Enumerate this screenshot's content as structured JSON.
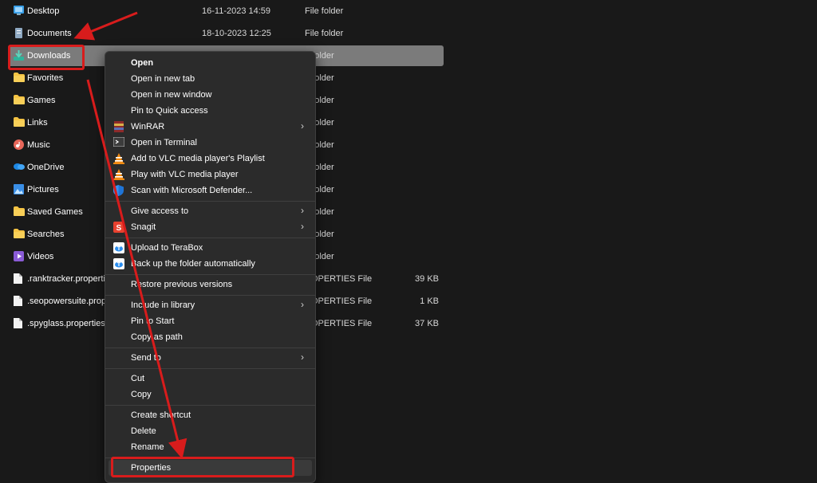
{
  "files": [
    {
      "name": "Desktop",
      "date": "16-11-2023 14:59",
      "type": "File folder",
      "size": "",
      "icon": "desktop-icon"
    },
    {
      "name": "Documents",
      "date": "18-10-2023 12:25",
      "type": "File folder",
      "size": "",
      "icon": "documents-icon"
    },
    {
      "name": "Downloads",
      "date": "",
      "type": "e folder",
      "size": "",
      "icon": "downloads-icon",
      "selected": true
    },
    {
      "name": "Favorites",
      "date": "",
      "type": "e folder",
      "size": "",
      "icon": "folder-icon"
    },
    {
      "name": "Games",
      "date": "",
      "type": "e folder",
      "size": "",
      "icon": "folder-icon"
    },
    {
      "name": "Links",
      "date": "",
      "type": "e folder",
      "size": "",
      "icon": "folder-icon"
    },
    {
      "name": "Music",
      "date": "",
      "type": "e folder",
      "size": "",
      "icon": "music-icon"
    },
    {
      "name": "OneDrive",
      "date": "",
      "type": "e folder",
      "size": "",
      "icon": "onedrive-icon"
    },
    {
      "name": "Pictures",
      "date": "",
      "type": "e folder",
      "size": "",
      "icon": "pictures-icon"
    },
    {
      "name": "Saved Games",
      "date": "",
      "type": "e folder",
      "size": "",
      "icon": "folder-icon"
    },
    {
      "name": "Searches",
      "date": "",
      "type": "e folder",
      "size": "",
      "icon": "folder-icon"
    },
    {
      "name": "Videos",
      "date": "",
      "type": "e folder",
      "size": "",
      "icon": "videos-icon"
    },
    {
      "name": ".ranktracker.properties",
      "date": "",
      "type": "ROPERTIES File",
      "size": "39 KB",
      "icon": "file-icon"
    },
    {
      "name": ".seopowersuite.properties",
      "date": "",
      "type": "ROPERTIES File",
      "size": "1 KB",
      "icon": "file-icon"
    },
    {
      "name": ".spyglass.properties",
      "date": "",
      "type": "ROPERTIES File",
      "size": "37 KB",
      "icon": "file-icon"
    }
  ],
  "menu": {
    "groups": [
      [
        {
          "label": "Open",
          "bold": true
        },
        {
          "label": "Open in new tab"
        },
        {
          "label": "Open in new window"
        },
        {
          "label": "Pin to Quick access"
        },
        {
          "label": "WinRAR",
          "icon": "winrar-icon",
          "submenu": true
        },
        {
          "label": "Open in Terminal",
          "icon": "terminal-icon"
        },
        {
          "label": "Add to VLC media player's Playlist",
          "icon": "vlc-icon"
        },
        {
          "label": "Play with VLC media player",
          "icon": "vlc-icon"
        },
        {
          "label": "Scan with Microsoft Defender...",
          "icon": "defender-shield-icon"
        }
      ],
      [
        {
          "label": "Give access to",
          "submenu": true
        },
        {
          "label": "Snagit",
          "icon": "snagit-icon",
          "submenu": true
        }
      ],
      [
        {
          "label": "Upload to TeraBox",
          "icon": "terabox-icon"
        },
        {
          "label": "Back up the folder automatically",
          "icon": "terabox-icon"
        }
      ],
      [
        {
          "label": "Restore previous versions"
        }
      ],
      [
        {
          "label": "Include in library",
          "submenu": true
        },
        {
          "label": "Pin to Start"
        },
        {
          "label": "Copy as path"
        }
      ],
      [
        {
          "label": "Send to",
          "submenu": true
        }
      ],
      [
        {
          "label": "Cut"
        },
        {
          "label": "Copy"
        }
      ],
      [
        {
          "label": "Create shortcut"
        },
        {
          "label": "Delete"
        },
        {
          "label": "Rename"
        }
      ],
      [
        {
          "label": "Properties",
          "highlighted": true
        }
      ]
    ]
  },
  "colors": {
    "background": "#191919",
    "menu_background": "#2b2b2b",
    "selection": "#7b7b7b",
    "annotation_red": "#d81c1c",
    "folder_yellow": "#f5c343"
  }
}
